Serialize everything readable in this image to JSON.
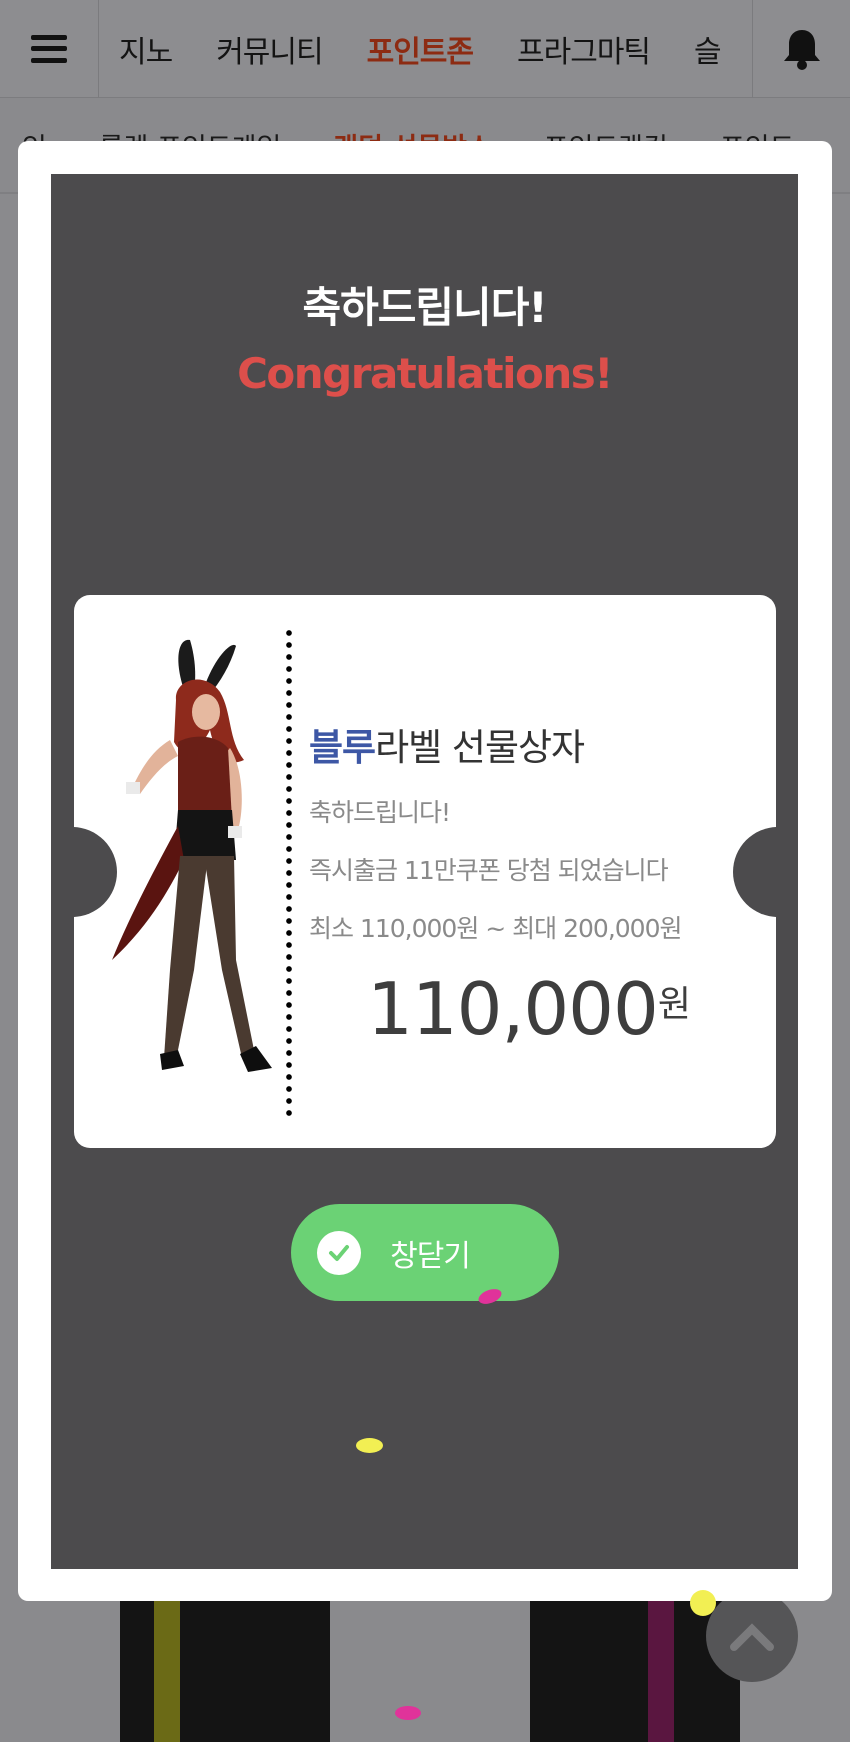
{
  "topnav": {
    "items": [
      {
        "label": "지노"
      },
      {
        "label": "커뮤니티"
      },
      {
        "label": "포인트존",
        "active": true
      },
      {
        "label": "프라그마틱"
      },
      {
        "label": "슬"
      }
    ]
  },
  "subnav": {
    "items": [
      {
        "label": "인"
      },
      {
        "label": "룰렛 포인트게임"
      },
      {
        "label": "랜덤 선물박스",
        "active": true
      },
      {
        "label": "포인트랭킹"
      },
      {
        "label": "포인트"
      }
    ]
  },
  "modal": {
    "title_ko": "축하드립니다!",
    "title_en": "Congratulations!",
    "coupon": {
      "title_highlight": "블루",
      "title_rest": "라벨 선물상자",
      "line1": "축하드립니다!",
      "line2": "즉시출금 11만쿠폰 당첨 되었습니다",
      "line3": "최소 110,000원 ~ 최대 200,000원",
      "amount": "110,000",
      "amount_unit": "원"
    },
    "close_button": {
      "label": "창닫기"
    }
  },
  "colors": {
    "modal_inner_bg": "#4c4b4d",
    "title_en": "#dd4f4b",
    "coupon_highlight": "#3d57a5",
    "close_button_bg": "#6bd275",
    "nav_active": "#8d2b12"
  },
  "icons": {
    "menu": "hamburger-icon",
    "notifications": "bell-icon",
    "close_button_check": "check-icon",
    "scroll_top": "chevron-up-icon"
  }
}
